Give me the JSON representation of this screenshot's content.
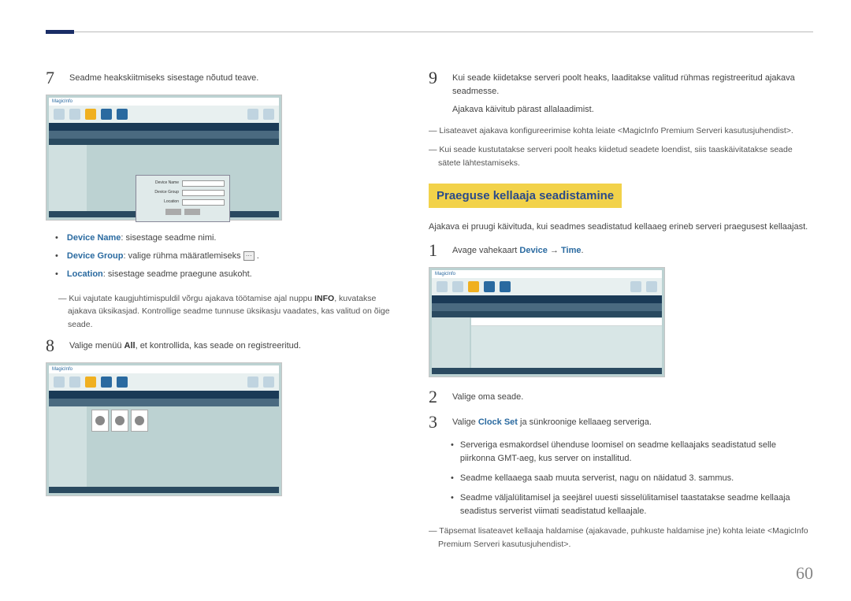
{
  "page_number": "60",
  "left": {
    "step7": {
      "num": "7",
      "text": "Seadme heakskiitmiseks sisestage nõutud teave."
    },
    "screenshot1": {
      "title": "MagicInfo",
      "dialog_fields": [
        "Device Name",
        "Device Group",
        "Location"
      ]
    },
    "bullets": [
      {
        "label": "Device Name",
        "tail": ": sisestage seadme nimi."
      },
      {
        "label": "Device Group",
        "tail": ": valige rühma määratlemiseks "
      },
      {
        "label": "Location",
        "tail": ": sisestage seadme praegune asukoht."
      }
    ],
    "btn_ellipsis": "···",
    "note1_pre": "Kui vajutate kaugjuhtimispuldil võrgu ajakava töötamise ajal nuppu ",
    "note1_bold": "INFO",
    "note1_post": ", kuvatakse ajakava üksikasjad. Kontrollige seadme tunnuse üksikasju vaadates, kas valitud on õige seade.",
    "step8": {
      "num": "8",
      "pre": "Valige menüü ",
      "bold": "All",
      "post": ", et kontrollida, kas seade on registreeritud."
    },
    "screenshot2": {
      "title": "MagicInfo"
    }
  },
  "right": {
    "step9": {
      "num": "9",
      "line1": "Kui seade kiidetakse serveri poolt heaks, laaditakse valitud rühmas registreeritud ajakava seadmesse.",
      "line2": "Ajakava käivitub pärast allalaadimist."
    },
    "note_a": "Lisateavet ajakava konfigureerimise kohta leiate <MagicInfo Premium Serveri kasutusjuhendist>.",
    "note_b": "Kui seade kustutatakse serveri poolt heaks kiidetud seadete loendist, siis taaskäivitatakse seade sätete lähtestamiseks.",
    "section_title": "Praeguse kellaaja seadistamine",
    "intro": "Ajakava ei pruugi käivituda, kui seadmes seadistatud kellaaeg erineb serveri praegusest kellaajast.",
    "step1": {
      "num": "1",
      "pre": "Avage vahekaart ",
      "b1": "Device",
      "arrow": " → ",
      "b2": "Time",
      "post": "."
    },
    "screenshot3": {
      "title": "MagicInfo"
    },
    "step2": {
      "num": "2",
      "text": "Valige oma seade."
    },
    "step3": {
      "num": "3",
      "pre": "Valige ",
      "b": "Clock Set",
      "post": " ja sünkroonige kellaaeg serveriga."
    },
    "sub_bullets": [
      "Serveriga esmakordsel ühenduse loomisel on seadme kellaajaks seadistatud selle piirkonna GMT-aeg, kus server on installitud.",
      "Seadme kellaaega saab muuta serverist, nagu on näidatud 3. sammus.",
      "Seadme väljalülitamisel ja seejärel uuesti sisselülitamisel taastatakse seadme kellaaja seadistus serverist viimati seadistatud kellaajale."
    ],
    "note_c": "Täpsemat lisateavet kellaaja haldamise (ajakavade, puhkuste haldamise jne) kohta leiate <MagicInfo Premium Serveri kasutusjuhendist>."
  }
}
